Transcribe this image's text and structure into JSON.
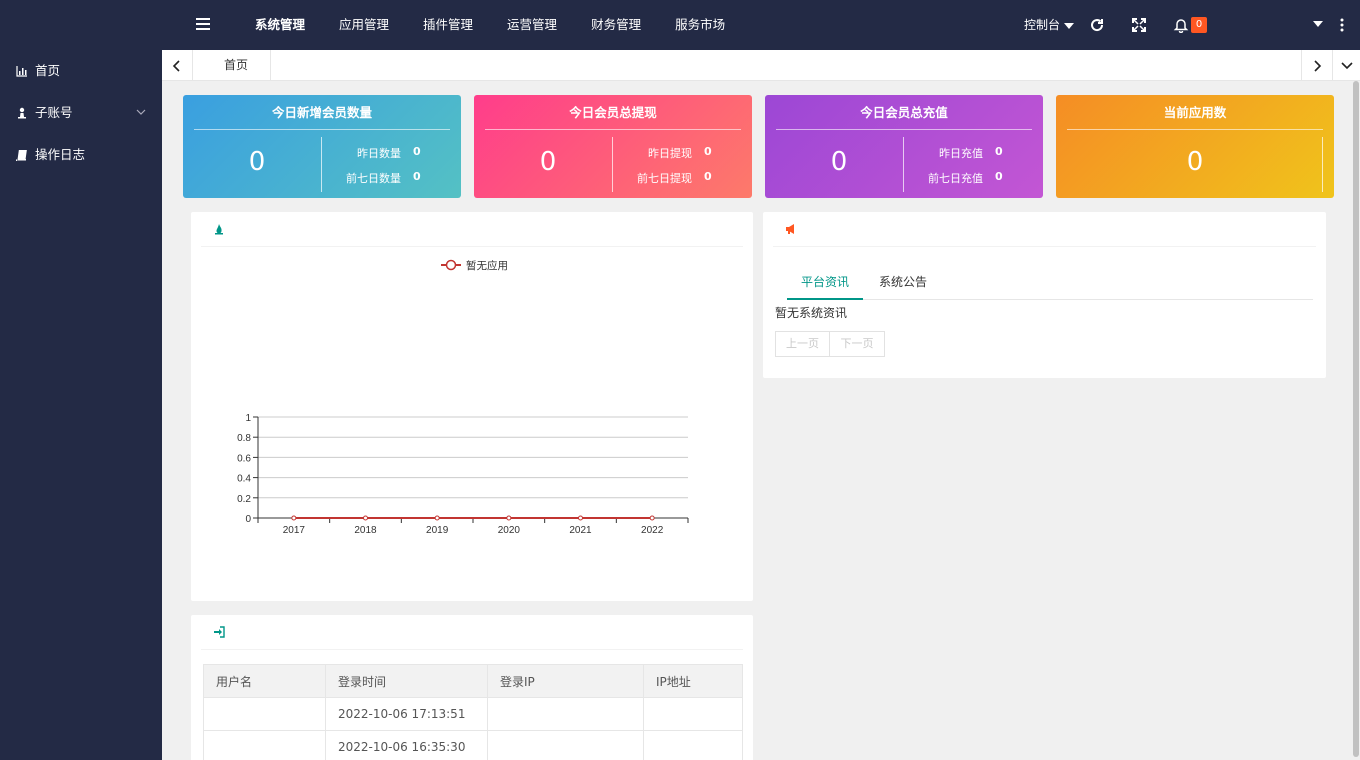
{
  "topnav": {
    "items": [
      {
        "label": "系统管理",
        "active": true
      },
      {
        "label": "应用管理"
      },
      {
        "label": "插件管理"
      },
      {
        "label": "运营管理"
      },
      {
        "label": "财务管理"
      },
      {
        "label": "服务市场"
      }
    ],
    "console_label": "控制台",
    "notification_count": "0"
  },
  "sidebar": {
    "items": [
      {
        "label": "首页",
        "icon": "bar-chart-icon"
      },
      {
        "label": "子账号",
        "icon": "user-icon",
        "expandable": true
      },
      {
        "label": "操作日志",
        "icon": "book-icon"
      }
    ]
  },
  "tabbar": {
    "home_tab": "首页"
  },
  "stats": [
    {
      "title": "今日新增会员数量",
      "value": "0",
      "sub": [
        {
          "label": "昨日数量",
          "value": "0"
        },
        {
          "label": "前七日数量",
          "value": "0"
        }
      ]
    },
    {
      "title": "今日会员总提现",
      "value": "0",
      "sub": [
        {
          "label": "昨日提现",
          "value": "0"
        },
        {
          "label": "前七日提现",
          "value": "0"
        }
      ]
    },
    {
      "title": "今日会员总充值",
      "value": "0",
      "sub": [
        {
          "label": "昨日充值",
          "value": "0"
        },
        {
          "label": "前七日充值",
          "value": "0"
        }
      ]
    },
    {
      "title": "当前应用数",
      "value": "0",
      "sub": []
    }
  ],
  "chart_data": {
    "type": "line",
    "x": [
      "2017",
      "2018",
      "2019",
      "2020",
      "2021",
      "2022"
    ],
    "series": [
      {
        "name": "暂无应用",
        "values": [
          0,
          0,
          0,
          0,
          0,
          0
        ],
        "color": "#c23531"
      }
    ],
    "ylim": [
      0,
      1
    ],
    "yticks": [
      "0",
      "0.2",
      "0.4",
      "0.6",
      "0.8",
      "1"
    ],
    "grid": true,
    "legend": "top-center"
  },
  "news": {
    "tabs": [
      "平台资讯",
      "系统公告"
    ],
    "active_tab": 0,
    "empty_text": "暂无系统资讯",
    "prev_label": "上一页",
    "next_label": "下一页"
  },
  "login_log": {
    "headers": [
      "用户名",
      "登录时间",
      "登录IP",
      "IP地址"
    ],
    "rows": [
      [
        "",
        "2022-10-06 17:13:51",
        "",
        ""
      ],
      [
        "",
        "2022-10-06 16:35:30",
        "",
        ""
      ]
    ]
  },
  "colors": {
    "sidebar_bg": "#232a45",
    "accent": "#009688",
    "badge": "#ff5722"
  }
}
